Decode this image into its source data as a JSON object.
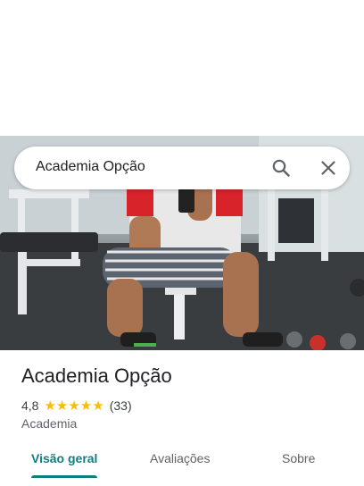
{
  "search": {
    "query": "Academia Opção"
  },
  "place": {
    "name": "Academia Opção",
    "rating": "4,8",
    "stars": "★★★★★",
    "review_count": "(33)",
    "category": "Academia"
  },
  "tabs": [
    {
      "label": "Visão geral",
      "active": true
    },
    {
      "label": "Avaliações",
      "active": false
    },
    {
      "label": "Sobre",
      "active": false
    }
  ],
  "colors": {
    "accent": "#127d7e",
    "star": "#fbbc04"
  }
}
